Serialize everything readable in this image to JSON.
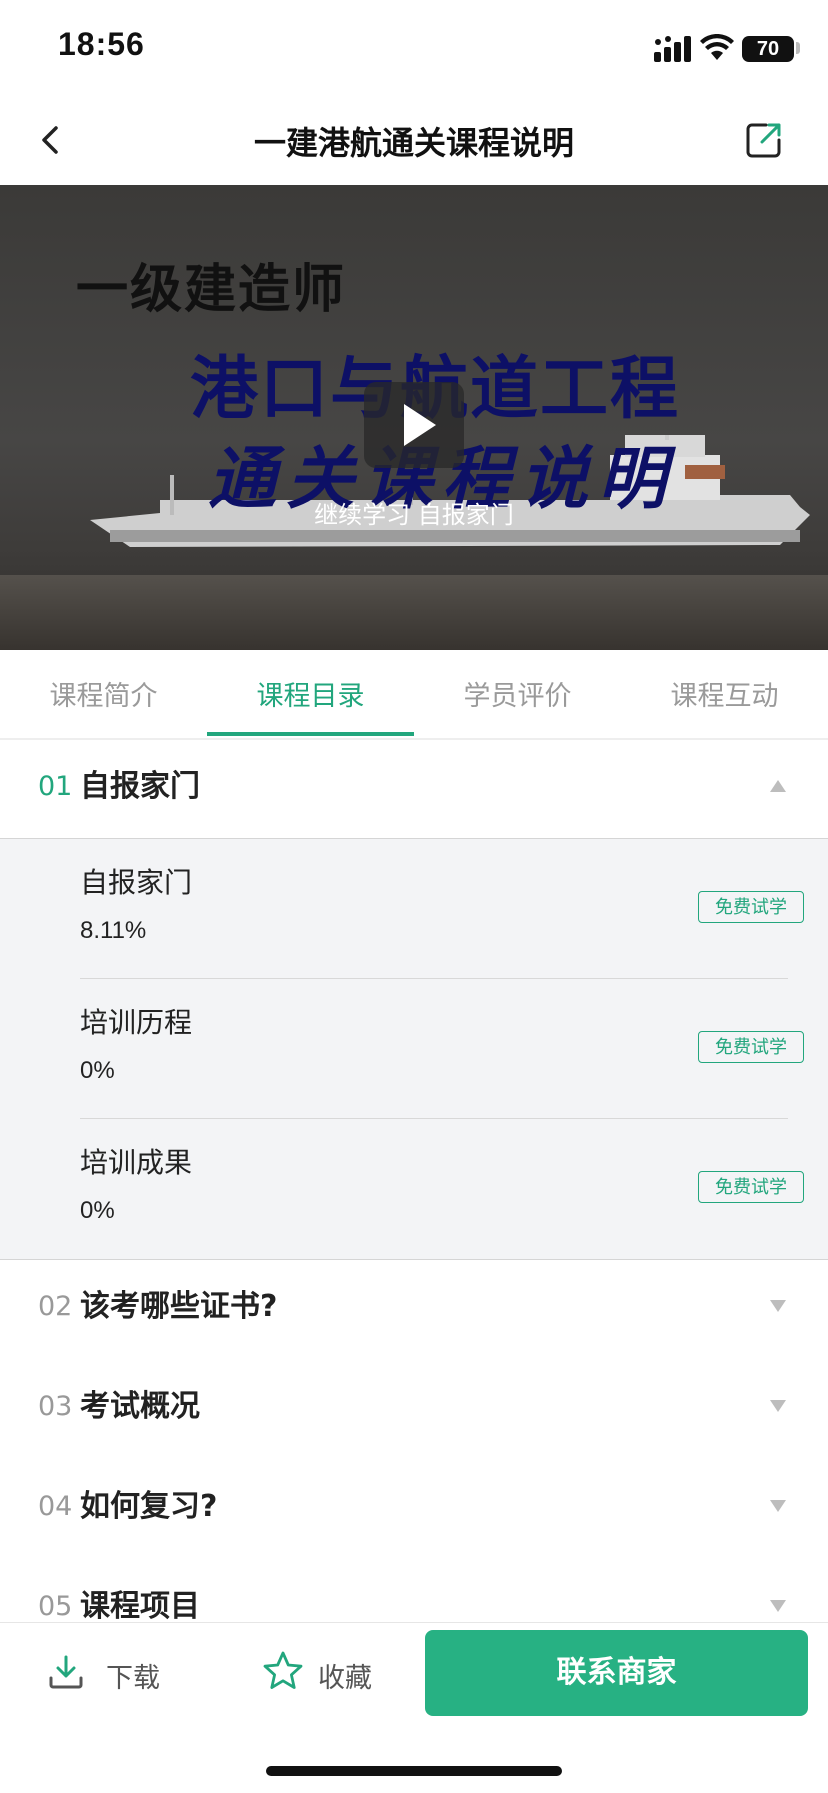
{
  "status_bar": {
    "time": "18:56",
    "battery": "70"
  },
  "nav": {
    "title": "一建港航通关课程说明"
  },
  "video": {
    "title_line1": "一级建造师",
    "title_line2": "港口与航道工程",
    "title_line3": "通关课程说明",
    "continue_text": "继续学习 自报家门"
  },
  "tabs": [
    {
      "label": "课程简介"
    },
    {
      "label": "课程目录"
    },
    {
      "label": "学员评价"
    },
    {
      "label": "课程互动"
    }
  ],
  "active_tab": "课程目录",
  "chapters": [
    {
      "num": "01",
      "title": "自报家门",
      "expanded": true
    },
    {
      "num": "02",
      "title": "该考哪些证书?",
      "expanded": false
    },
    {
      "num": "03",
      "title": "考试概况",
      "expanded": false
    },
    {
      "num": "04",
      "title": "如何复习?",
      "expanded": false
    },
    {
      "num": "05",
      "title": "课程项目",
      "expanded": false
    }
  ],
  "lessons": [
    {
      "title": "自报家门",
      "progress": "8.11%",
      "badge": "免费试学"
    },
    {
      "title": "培训历程",
      "progress": "0%",
      "badge": "免费试学"
    },
    {
      "title": "培训成果",
      "progress": "0%",
      "badge": "免费试学"
    }
  ],
  "bottom_bar": {
    "download_label": "下载",
    "favorite_label": "收藏",
    "contact_label": "联系商家"
  },
  "colors": {
    "accent": "#22a67d",
    "button": "#27b183"
  }
}
